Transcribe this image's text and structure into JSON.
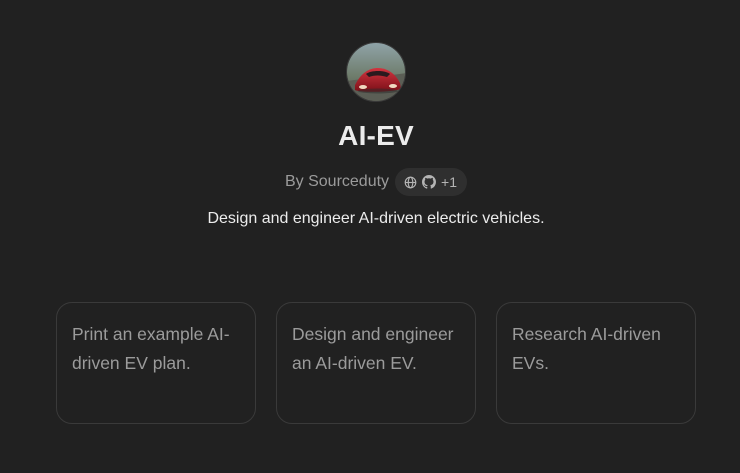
{
  "gpt": {
    "name": "AI-EV",
    "author": "By Sourceduty",
    "extra_links": "+1",
    "description": "Design and engineer AI-driven electric vehicles."
  },
  "icons": {
    "avatar": "red-sports-car-image",
    "web": "globe-icon",
    "repo": "github-icon"
  },
  "conversation_starters": [
    "Print an example AI-driven EV plan.",
    "Design and engineer an AI-driven EV.",
    "Research AI-driven EVs."
  ],
  "colors": {
    "background": "#212121",
    "card_border": "#3a3a3a",
    "muted_text": "#9b9b9b",
    "primary_text": "#ececec",
    "pill_background": "#2f2f2f"
  }
}
